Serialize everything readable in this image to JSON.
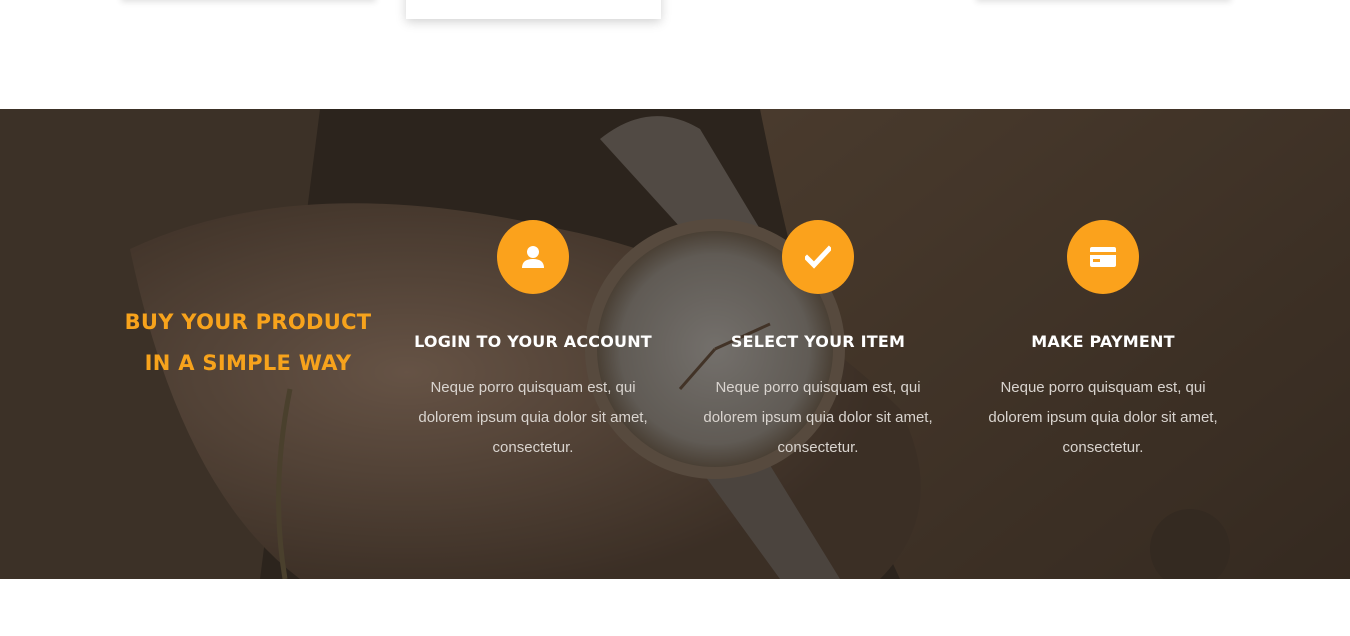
{
  "hero": {
    "tagline_line1": "BUY YOUR PRODUCT",
    "tagline_line2": "IN A SIMPLE WAY",
    "accent_color": "#fba21c",
    "steps": [
      {
        "icon": "user-icon",
        "title": "LOGIN TO YOUR ACCOUNT",
        "text": "Neque porro quisquam est, qui dolorem ipsum quia dolor sit amet, consectetur."
      },
      {
        "icon": "check-icon",
        "title": "SELECT YOUR ITEM",
        "text": "Neque porro quisquam est, qui dolorem ipsum quia dolor sit amet, consectetur."
      },
      {
        "icon": "credit-card-icon",
        "title": "MAKE PAYMENT",
        "text": "Neque porro quisquam est, qui dolorem ipsum quia dolor sit amet, consectetur."
      }
    ]
  }
}
